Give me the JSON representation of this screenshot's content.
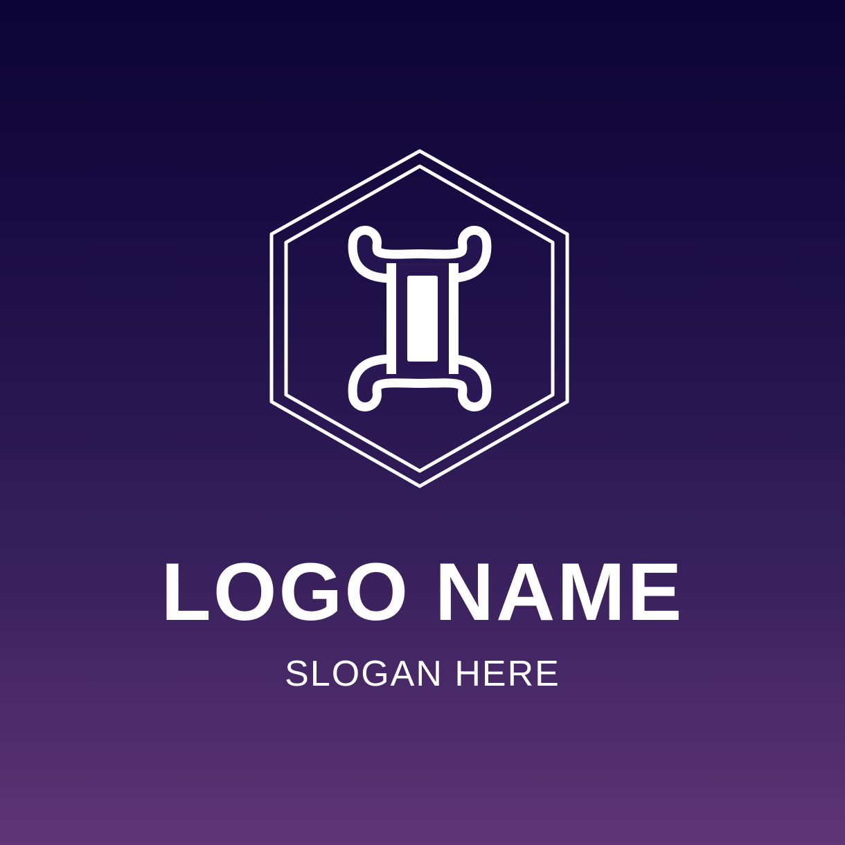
{
  "brand": {
    "name": "LOGO NAME",
    "slogan": "SLOGAN HERE"
  },
  "emblem": {
    "icon": "gemini-symbol-icon",
    "frame": "double-hexagon-outline"
  },
  "colors": {
    "background_top": "#0b0433",
    "background_bottom": "#5f3575",
    "foreground": "#ffffff"
  }
}
